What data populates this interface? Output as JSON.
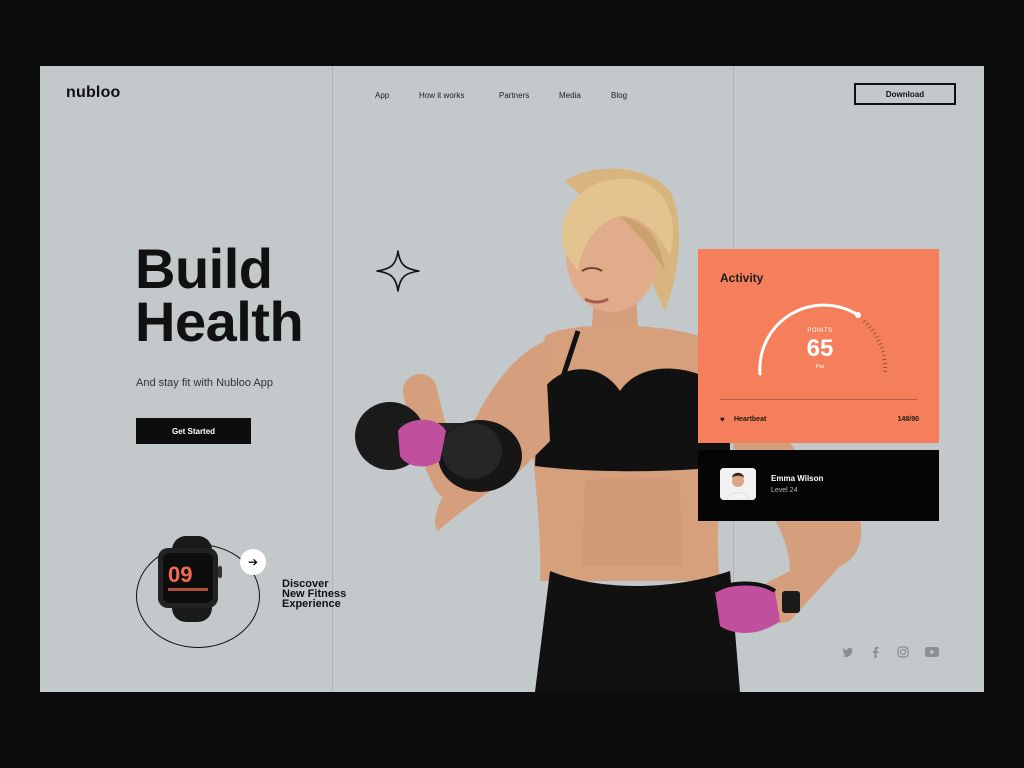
{
  "brand": {
    "logo": "nubloo"
  },
  "nav": {
    "items": [
      "App",
      "How it works",
      "Partners",
      "Media",
      "Blog"
    ],
    "download_label": "Download"
  },
  "hero": {
    "headline_line1": "Build",
    "headline_line2": "Health",
    "tagline": "And stay fit with Nubloo App",
    "cta_label": "Get Started"
  },
  "watch_promo": {
    "watch_time": "09",
    "lines": [
      "Discover",
      "New Fitness",
      "Experience"
    ]
  },
  "activity_card": {
    "title": "Activity",
    "points_label": "POINTS",
    "points_value": "65",
    "points_unit": "Pso",
    "heartbeat_label": "Heartbeat",
    "heartbeat_value": "148/90",
    "color": "#f57f5a"
  },
  "profile_card": {
    "name": "Emma Wilson",
    "level": "Level 24"
  },
  "social": [
    "twitter-icon",
    "facebook-icon",
    "instagram-icon",
    "youtube-icon"
  ]
}
